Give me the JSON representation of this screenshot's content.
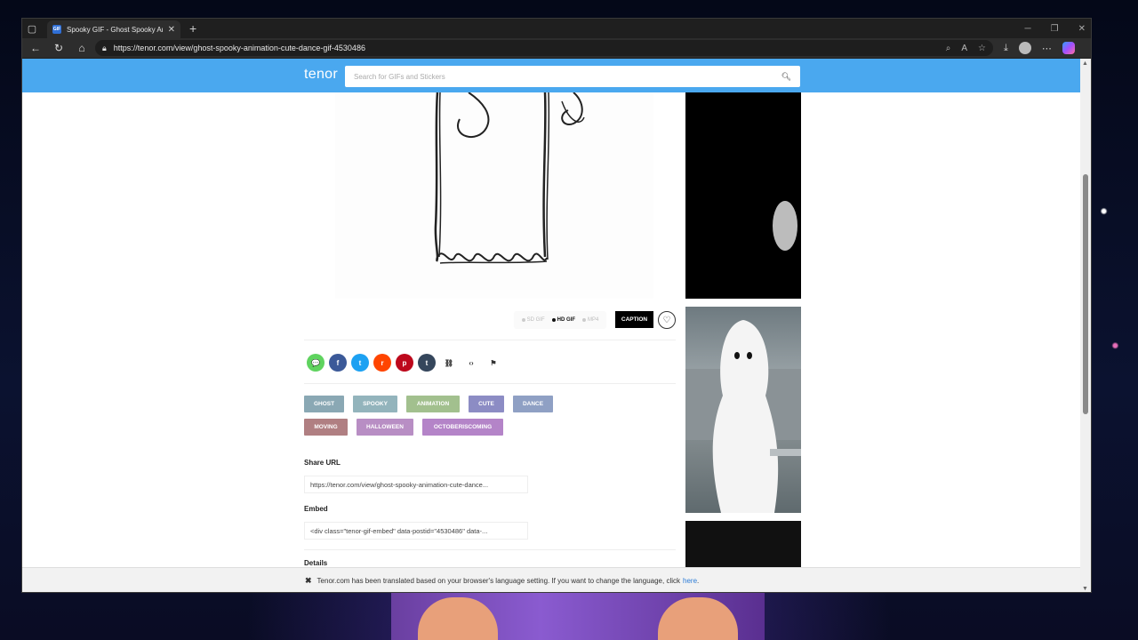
{
  "browser": {
    "tab_title": "Spooky GIF - Ghost Spooky Anim",
    "favicon_text": "GIF",
    "url": "https://tenor.com/view/ghost-spooky-animation-cute-dance-gif-4530486"
  },
  "header": {
    "logo": "tenor",
    "search_placeholder": "Search for GIFs and Stickers"
  },
  "gif_options": {
    "qualities": [
      {
        "label": "SD GIF",
        "active": false
      },
      {
        "label": "HD GIF",
        "active": true
      },
      {
        "label": "MP4",
        "active": false
      }
    ],
    "caption_label": "CAPTION"
  },
  "share_icons": [
    {
      "name": "message-icon",
      "glyph": "💬",
      "color": "#5fd35f"
    },
    {
      "name": "facebook-icon",
      "glyph": "f",
      "color": "#3b5998"
    },
    {
      "name": "twitter-icon",
      "glyph": "t",
      "color": "#1da1f2"
    },
    {
      "name": "reddit-icon",
      "glyph": "r",
      "color": "#ff4500"
    },
    {
      "name": "pinterest-icon",
      "glyph": "p",
      "color": "#bd081c"
    },
    {
      "name": "tumblr-icon",
      "glyph": "t",
      "color": "#35465c"
    },
    {
      "name": "link-icon",
      "glyph": "⛓",
      "color": "#ffffff"
    },
    {
      "name": "embed-icon",
      "glyph": "‹›",
      "color": "#ffffff"
    },
    {
      "name": "flag-icon",
      "glyph": "⚑",
      "color": "#ffffff"
    }
  ],
  "tags": [
    {
      "label": "GHOST",
      "color": "#8aa8b4"
    },
    {
      "label": "SPOOKY",
      "color": "#93b4bc"
    },
    {
      "label": "ANIMATION",
      "color": "#a2c08e"
    },
    {
      "label": "CUTE",
      "color": "#8c8cc4"
    },
    {
      "label": "DANCE",
      "color": "#8fa0c4"
    },
    {
      "label": "MOVING",
      "color": "#b07f82"
    },
    {
      "label": "HALLOWEEN",
      "color": "#b88ec4"
    },
    {
      "label": "OCTOBERISCOMING",
      "color": "#b484c8"
    }
  ],
  "share_url": {
    "label": "Share URL",
    "value": "https://tenor.com/view/ghost-spooky-animation-cute-dance..."
  },
  "embed": {
    "label": "Embed",
    "value": "<div class=\"tenor-gif-embed\" data-postid=\"4530486\" data-..."
  },
  "details_label": "Details",
  "translate_bar": {
    "message": "Tenor.com has been translated based on your browser's language setting. If you want to change the language, click",
    "link": "here",
    "suffix": "."
  }
}
